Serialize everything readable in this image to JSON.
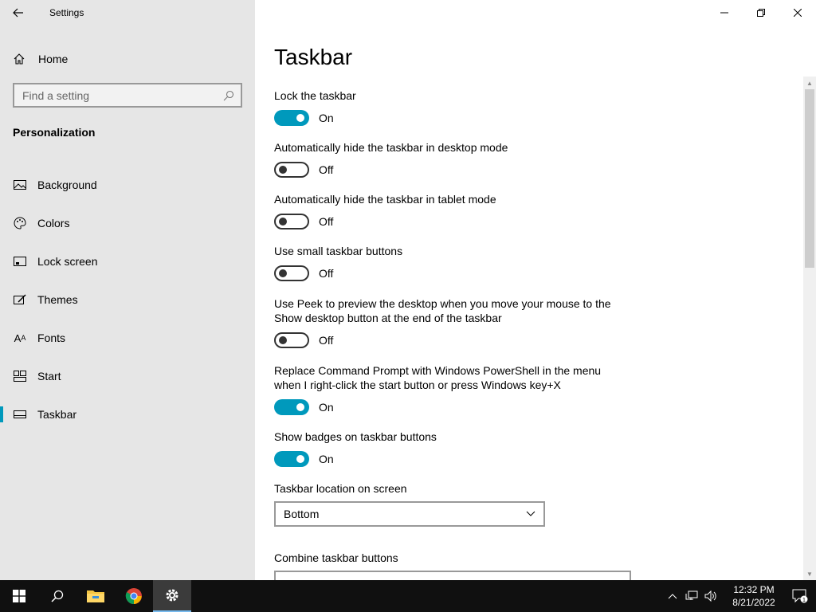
{
  "window": {
    "title": "Settings"
  },
  "sidebar": {
    "home_label": "Home",
    "search_placeholder": "Find a setting",
    "section_title": "Personalization",
    "items": [
      {
        "label": "Background",
        "icon": "image-icon"
      },
      {
        "label": "Colors",
        "icon": "palette-icon"
      },
      {
        "label": "Lock screen",
        "icon": "lock-screen-icon"
      },
      {
        "label": "Themes",
        "icon": "themes-icon"
      },
      {
        "label": "Fonts",
        "icon": "fonts-icon"
      },
      {
        "label": "Start",
        "icon": "start-icon"
      },
      {
        "label": "Taskbar",
        "icon": "taskbar-icon",
        "selected": true
      }
    ]
  },
  "main": {
    "page_title": "Taskbar",
    "settings": [
      {
        "label": "Lock the taskbar",
        "state": "On"
      },
      {
        "label": "Automatically hide the taskbar in desktop mode",
        "state": "Off"
      },
      {
        "label": "Automatically hide the taskbar in tablet mode",
        "state": "Off"
      },
      {
        "label": "Use small taskbar buttons",
        "state": "Off"
      },
      {
        "label": "Use Peek to preview the desktop when you move your mouse to the Show desktop button at the end of the taskbar",
        "state": "Off"
      },
      {
        "label": "Replace Command Prompt with Windows PowerShell in the menu when I right-click the start button or press Windows key+X",
        "state": "On"
      },
      {
        "label": "Show badges on taskbar buttons",
        "state": "On"
      }
    ],
    "location_label": "Taskbar location on screen",
    "location_value": "Bottom",
    "combine_label": "Combine taskbar buttons"
  },
  "taskbar": {
    "time": "12:32 PM",
    "date": "8/21/2022",
    "notification_count": "1"
  },
  "colors": {
    "accent": "#0099bc",
    "sidebar_bg": "#e6e6e6",
    "taskbar_bg": "#101010"
  }
}
